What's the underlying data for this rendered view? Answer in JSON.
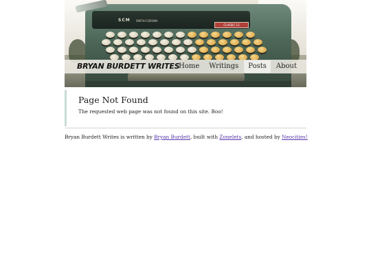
{
  "header": {
    "site_title": "Bryan Burdett Writes",
    "typewriter_brand": "SCM",
    "typewriter_model": "SMITH-CORONA",
    "typewriter_badge": "CLASSIC 12",
    "nav": [
      {
        "label": "Home",
        "active": false
      },
      {
        "label": "Writings",
        "active": false
      },
      {
        "label": "Posts",
        "active": true
      },
      {
        "label": "About",
        "active": false
      }
    ]
  },
  "main": {
    "heading": "Page Not Found",
    "message": "The requested web page was not found on this site. Boo!"
  },
  "footer": {
    "text_1": "Bryan Burdett Writes is written by ",
    "link_author": "Bryan Burdett",
    "text_2": ", built with ",
    "link_builder": "Zonelets",
    "text_3": ", and hosted by ",
    "link_host": "Neocities!"
  },
  "colors": {
    "link": "#5533aa",
    "accent_border": "#c9dcd7",
    "typewriter_green": "#4c6657"
  }
}
